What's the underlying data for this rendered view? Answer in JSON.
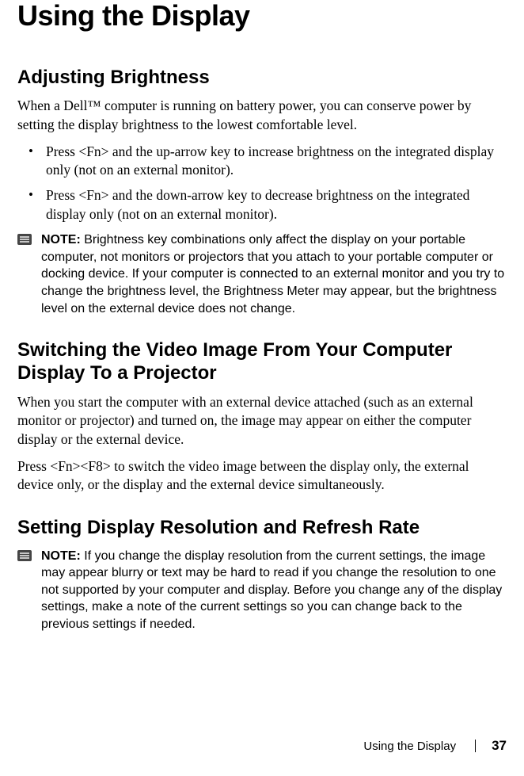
{
  "title": "Using the Display",
  "section1": {
    "heading": "Adjusting Brightness",
    "para1": "When a Dell™ computer is running on battery power, you can conserve power by setting the display brightness to the lowest comfortable level.",
    "bullets": [
      "Press <Fn> and the up-arrow key to increase brightness on the integrated display only (not on an external monitor).",
      "Press <Fn> and the down-arrow key to decrease brightness on the integrated display only (not on an external monitor)."
    ],
    "note_label": "NOTE:",
    "note_text": " Brightness key combinations only affect the display on your portable computer, not monitors or projectors that you attach to your portable computer or docking device. If your computer is connected to an external monitor and you try to change the brightness level, the Brightness Meter may appear, but the brightness level on the external device does not change."
  },
  "section2": {
    "heading": "Switching the Video Image From Your Computer Display To a Projector",
    "para1": "When you start the computer with an external device attached (such as an external monitor or projector) and turned on, the image may appear on either the computer display or the external device.",
    "para2": "Press <Fn><F8> to switch the video image between the display only, the external device only, or the display and the external device simultaneously."
  },
  "section3": {
    "heading": "Setting Display Resolution and Refresh Rate",
    "note_label": "NOTE:",
    "note_text": " If you change the display resolution from the current settings, the image may appear blurry or text may be hard to read if you change the resolution to one not supported by your computer and display. Before you change any of the display settings, make a note of the current settings so you can change back to the previous settings if needed."
  },
  "footer": {
    "title": "Using the Display",
    "page": "37"
  }
}
